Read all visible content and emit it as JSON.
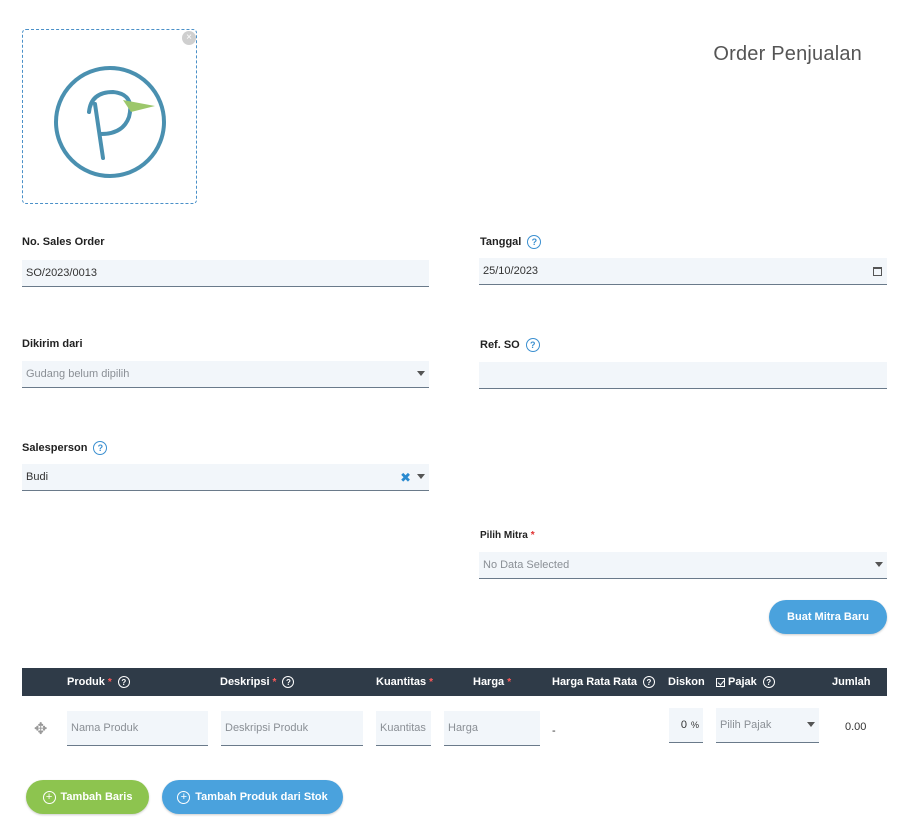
{
  "header": {
    "title": "Order Penjualan"
  },
  "logo": {
    "close_icon": "×",
    "brand_color": "#4a90b0",
    "accent_color": "#9cc76b"
  },
  "form": {
    "no_so": {
      "label": "No. Sales Order",
      "value": "SO/2023/0013"
    },
    "tanggal": {
      "label": "Tanggal",
      "value": "25/10/2023"
    },
    "dikirim": {
      "label": "Dikirim dari",
      "placeholder": "Gudang belum dipilih"
    },
    "ref_so": {
      "label": "Ref. SO",
      "value": ""
    },
    "salesperson": {
      "label": "Salesperson",
      "value": "Budi"
    },
    "mitra": {
      "label": "Pilih Mitra",
      "required": "*",
      "placeholder": "No Data Selected"
    },
    "help": "?",
    "clear": "✖"
  },
  "buttons": {
    "buat_mitra": "Buat Mitra Baru",
    "tambah_baris": "Tambah Baris",
    "tambah_stok": "Tambah Produk dari Stok",
    "plus": "+"
  },
  "table": {
    "headers": {
      "produk": "Produk",
      "deskripsi": "Deskripsi",
      "kuantitas": "Kuantitas",
      "harga": "Harga",
      "harga_rata": "Harga Rata Rata",
      "diskon": "Diskon",
      "pajak": "Pajak",
      "jumlah": "Jumlah",
      "req": "*"
    },
    "row": {
      "drag_icon": "✥",
      "produk_ph": "Nama Produk",
      "deskripsi_ph": "Deskripsi Produk",
      "kuantitas_ph": "Kuantitas",
      "harga_ph": "Harga",
      "harga_rata": "-",
      "diskon": "0",
      "diskon_unit": "%",
      "pajak_ph": "Pilih Pajak",
      "jumlah": "0.00"
    }
  },
  "colors": {
    "primary": "#4aa2dd",
    "success": "#8dc44f",
    "header_bg": "#2f3b48"
  }
}
